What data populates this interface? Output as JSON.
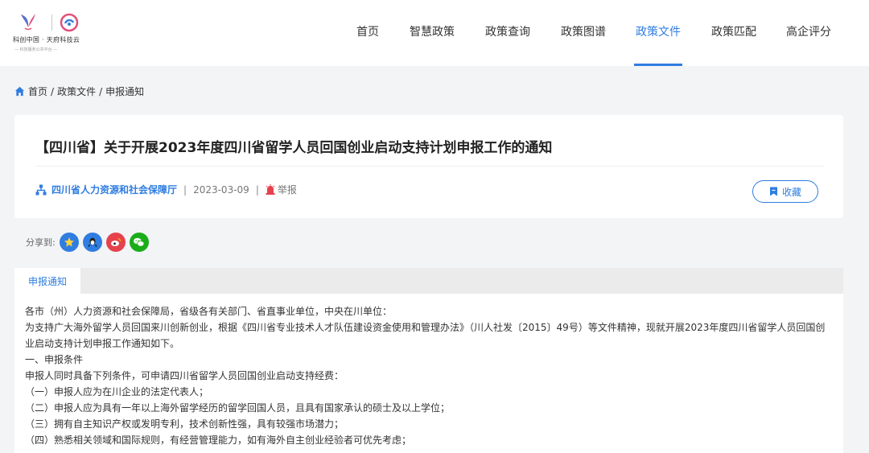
{
  "header": {
    "logo": {
      "brand_text": "科创中国 · 天府科技云",
      "slogan_text": "— 科技服务公共平台 —"
    },
    "nav": [
      {
        "label": "首页",
        "active": false
      },
      {
        "label": "智慧政策",
        "active": false
      },
      {
        "label": "政策查询",
        "active": false
      },
      {
        "label": "政策图谱",
        "active": false
      },
      {
        "label": "政策文件",
        "active": true
      },
      {
        "label": "政策匹配",
        "active": false
      },
      {
        "label": "高企评分",
        "active": false
      }
    ]
  },
  "breadcrumb": {
    "icon": "home-icon",
    "items": [
      "首页",
      "政策文件",
      "申报通知"
    ],
    "separator": "/"
  },
  "article": {
    "title": "【四川省】关于开展2023年度四川省留学人员回国创业启动支持计划申报工作的通知",
    "publisher": "四川省人力资源和社会保障厅",
    "date": "2023-03-09",
    "separator": "|",
    "report_label": "举报",
    "favorite_label": "收藏"
  },
  "share": {
    "label": "分享到:",
    "icons": [
      "qzone-icon",
      "qq-icon",
      "weibo-icon",
      "wechat-icon"
    ]
  },
  "tabs": [
    {
      "label": "申报通知",
      "active": true
    }
  ],
  "content": {
    "paragraphs": [
      "各市（州）人力资源和社会保障局，省级各有关部门、省直事业单位，中央在川单位：",
      "为支持广大海外留学人员回国来川创新创业，根据《四川省专业技术人才队伍建设资金使用和管理办法》（川人社发〔2015〕49号）等文件精神，现就开展2023年度四川省留学人员回国创业启动支持计划申报工作通知如下。",
      "一、申报条件",
      "申报人同时具备下列条件，可申请四川省留学人员回国创业启动支持经费：",
      "（一）申报人应为在川企业的法定代表人；",
      "（二）申报人应为具有一年以上海外留学经历的留学回国人员，且具有国家承认的硕士及以上学位；",
      "（三）拥有自主知识产权或发明专利，技术创新性强，具有较强市场潜力；",
      "（四）熟悉相关领域和国际规则，有经营管理能力，如有海外自主创业经验者可优先考虑；"
    ]
  },
  "colors": {
    "accent": "#2f7de1",
    "page_bg": "#f3f4f6",
    "qzone": "#2f7de1",
    "qq": "#2f7de1",
    "weibo": "#e6424d",
    "wechat": "#1aad19",
    "report": "#e6424d"
  }
}
